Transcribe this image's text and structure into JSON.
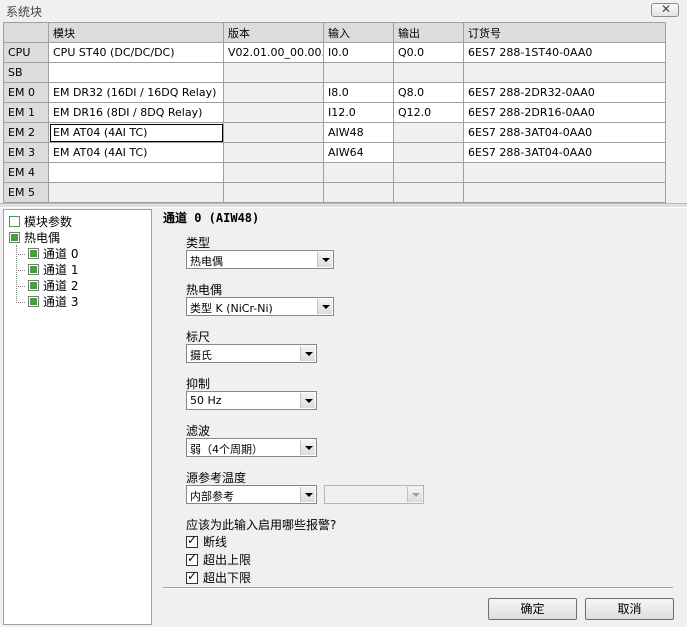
{
  "window": {
    "title": "系统块",
    "close_glyph": "✕"
  },
  "grid": {
    "headers": [
      "",
      "模块",
      "版本",
      "输入",
      "输出",
      "订货号"
    ],
    "rows": [
      [
        "CPU",
        "CPU ST40 (DC/DC/DC)",
        "V02.01.00_00.00...",
        "I0.0",
        "Q0.0",
        "6ES7 288-1ST40-0AA0"
      ],
      [
        "SB",
        "",
        "",
        "",
        "",
        ""
      ],
      [
        "EM 0",
        "EM DR32 (16DI / 16DQ Relay)",
        "",
        "I8.0",
        "Q8.0",
        "6ES7 288-2DR32-0AA0"
      ],
      [
        "EM 1",
        "EM DR16 (8DI / 8DQ Relay)",
        "",
        "I12.0",
        "Q12.0",
        "6ES7 288-2DR16-0AA0"
      ],
      [
        "EM 2",
        "EM AT04 (4AI TC)",
        "",
        "AIW48",
        "",
        "6ES7 288-3AT04-0AA0"
      ],
      [
        "EM 3",
        "EM AT04 (4AI TC)",
        "",
        "AIW64",
        "",
        "6ES7 288-3AT04-0AA0"
      ],
      [
        "EM 4",
        "",
        "",
        "",
        "",
        ""
      ],
      [
        "EM 5",
        "",
        "",
        "",
        "",
        ""
      ]
    ]
  },
  "tree": {
    "items": [
      {
        "label": "模块参数",
        "checked": false
      },
      {
        "label": "热电偶",
        "checked": true
      },
      {
        "label": "通道 0",
        "checked": true
      },
      {
        "label": "通道 1",
        "checked": true
      },
      {
        "label": "通道 2",
        "checked": true
      },
      {
        "label": "通道 3",
        "checked": true
      }
    ]
  },
  "panel": {
    "section_title": "通道 0 (AIW48)",
    "type_label": "类型",
    "type_value": "热电偶",
    "thermocouple_label": "热电偶",
    "thermocouple_value": "类型 K (NiCr-Ni)",
    "scale_label": "标尺",
    "scale_value": "摄氏",
    "rejection_label": "抑制",
    "rejection_value": "50 Hz",
    "filter_label": "滤波",
    "filter_value": "弱（4个周期）",
    "ref_label": "源参考温度",
    "ref_value": "内部参考",
    "ref_extra_value": "",
    "alarms_label": "应该为此输入启用哪些报警?",
    "alarms": [
      {
        "label": "断线",
        "checked": true
      },
      {
        "label": "超出上限",
        "checked": true
      },
      {
        "label": "超出下限",
        "checked": true
      }
    ]
  },
  "buttons": {
    "ok": "确定",
    "cancel": "取消"
  }
}
